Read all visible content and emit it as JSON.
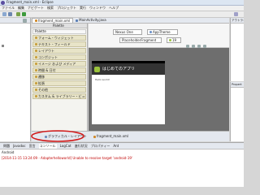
{
  "window": {
    "title": "Fragment_main.xml - Eclipse"
  },
  "menubar": [
    "ファイル",
    "編集",
    "ナビゲート",
    "検索",
    "プロジェクト",
    "実行",
    "ウィンドウ",
    "ヘルプ"
  ],
  "left_panel": {
    "placeholder": ""
  },
  "editor_tabs": [
    {
      "label": "fragment_main.xml",
      "active": true
    },
    {
      "label": "MainActivity.java",
      "active": false
    }
  ],
  "palette": {
    "title": "Palette",
    "sections": [
      "Palette",
      "フォーム・ウィジェット",
      "テキスト・フィールド",
      "レイアウト",
      "コンポジット",
      "イメージ および メディア",
      "時間 & 日付",
      "遷移",
      "拡張",
      "その他",
      "カスタム & ライブラリー・ビュー"
    ]
  },
  "toolbar": {
    "device": "Nexus One",
    "theme": "AppTheme",
    "fragment": "PlaceholderFragment",
    "api": "19"
  },
  "phone": {
    "app_title": "はじめてのアプリ",
    "content_text": "Hello world!"
  },
  "bottom_tabs": [
    {
      "label": "グラフィカル・レイアウト",
      "active": true
    },
    {
      "label": "fragment_main.xml",
      "active": false
    }
  ],
  "console": {
    "tabs": [
      "問題",
      "Javadoc",
      "宣言",
      "コンソール",
      "LogCat",
      "進行状況",
      "プロパティー",
      "Ant"
    ],
    "heading": "Android",
    "log_line": "[2014-11-15 13:24:09 - Adapterhelloworld] Unable to resolve target 'android-19'"
  },
  "right_panel": {
    "top_label": "アウトライン",
    "bottom_label": "Propert"
  },
  "colors": {
    "accent": "#c00000",
    "highlight_oval": "#d21a1a",
    "phone_actionbar": "#333333",
    "phone_bg": "#ffffff",
    "palette_section": "#e8e4c8"
  }
}
